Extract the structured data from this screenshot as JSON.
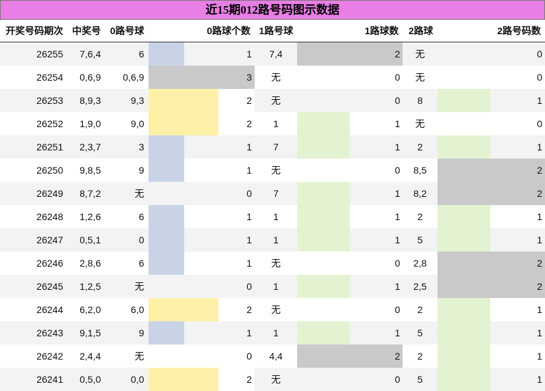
{
  "title": "近15期012路号码图示数据",
  "headers": [
    "开奖号码期次",
    "中奖号",
    "0路号球",
    "0路球个数",
    "1路号球",
    "1路球数",
    "2路球",
    "2路号码数"
  ],
  "colors": {
    "title_bg": "#e87ee6",
    "blue": "#c8d4e6",
    "yellow": "#fdf1a8",
    "gray": "#c9c9c9",
    "green": "#e3f3d2"
  },
  "rows": [
    {
      "issue": "26255",
      "win": "7,6,4",
      "r0": "6",
      "r0n": "1",
      "r1": "7,4",
      "r1n": "2",
      "r2": "无",
      "r2n": "0"
    },
    {
      "issue": "26254",
      "win": "0,6,9",
      "r0": "0,6,9",
      "r0n": "3",
      "r1": "无",
      "r1n": "0",
      "r2": "无",
      "r2n": "0"
    },
    {
      "issue": "26253",
      "win": "8,9,3",
      "r0": "9,3",
      "r0n": "2",
      "r1": "无",
      "r1n": "0",
      "r2": "8",
      "r2n": "1"
    },
    {
      "issue": "26252",
      "win": "1,9,0",
      "r0": "9,0",
      "r0n": "2",
      "r1": "1",
      "r1n": "1",
      "r2": "无",
      "r2n": "0"
    },
    {
      "issue": "26251",
      "win": "2,3,7",
      "r0": "3",
      "r0n": "1",
      "r1": "7",
      "r1n": "1",
      "r2": "2",
      "r2n": "1"
    },
    {
      "issue": "26250",
      "win": "9,8,5",
      "r0": "9",
      "r0n": "1",
      "r1": "无",
      "r1n": "0",
      "r2": "8,5",
      "r2n": "2"
    },
    {
      "issue": "26249",
      "win": "8,7,2",
      "r0": "无",
      "r0n": "0",
      "r1": "7",
      "r1n": "1",
      "r2": "8,2",
      "r2n": "2"
    },
    {
      "issue": "26248",
      "win": "1,2,6",
      "r0": "6",
      "r0n": "1",
      "r1": "1",
      "r1n": "1",
      "r2": "2",
      "r2n": "1"
    },
    {
      "issue": "26247",
      "win": "0,5,1",
      "r0": "0",
      "r0n": "1",
      "r1": "1",
      "r1n": "1",
      "r2": "5",
      "r2n": "1"
    },
    {
      "issue": "26246",
      "win": "2,8,6",
      "r0": "6",
      "r0n": "1",
      "r1": "无",
      "r1n": "0",
      "r2": "2,8",
      "r2n": "2"
    },
    {
      "issue": "26245",
      "win": "1,2,5",
      "r0": "无",
      "r0n": "0",
      "r1": "1",
      "r1n": "1",
      "r2": "2,5",
      "r2n": "2"
    },
    {
      "issue": "26244",
      "win": "6,2,0",
      "r0": "6,0",
      "r0n": "2",
      "r1": "无",
      "r1n": "0",
      "r2": "2",
      "r2n": "1"
    },
    {
      "issue": "26243",
      "win": "9,1,5",
      "r0": "9",
      "r0n": "1",
      "r1": "1",
      "r1n": "1",
      "r2": "5",
      "r2n": "1"
    },
    {
      "issue": "26242",
      "win": "2,4,4",
      "r0": "无",
      "r0n": "0",
      "r1": "4,4",
      "r1n": "2",
      "r2": "2",
      "r2n": "1"
    },
    {
      "issue": "26241",
      "win": "0,5,0",
      "r0": "0,0",
      "r0n": "2",
      "r1": "无",
      "r1n": "0",
      "r2": "5",
      "r2n": "1"
    }
  ]
}
